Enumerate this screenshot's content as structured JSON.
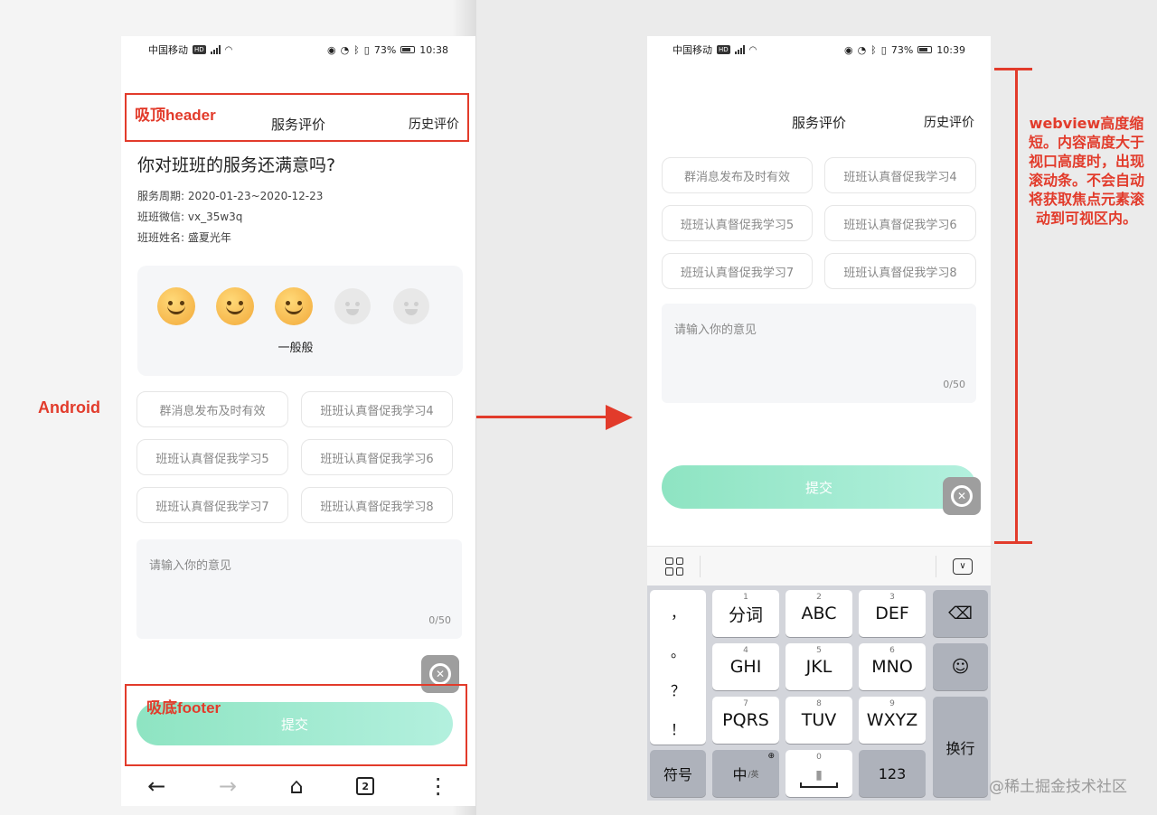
{
  "colors": {
    "annotation": "#e23b2b",
    "submit_gradient_start": "#8ee4c2",
    "submit_gradient_end": "#b3f0de"
  },
  "annotations": {
    "android_label": "Android",
    "header_label": "吸顶header",
    "footer_label": "吸底footer",
    "ios_note": "webview高度缩短。内容高度大于视口高度时，出现滚动条。不会自动将获取焦点元素滚动到可视区内。"
  },
  "left_phone": {
    "status": {
      "carrier": "中国移动",
      "hd": "HD",
      "signal": "4G",
      "battery": "73%",
      "time": "10:38"
    },
    "nav": {
      "title": "服务评价",
      "history": "历史评价"
    },
    "question": "你对班班的服务还满意吗?",
    "info": [
      {
        "label": "服务周期:",
        "value": "2020-01-23~2020-12-23"
      },
      {
        "label": "班班微信:",
        "value": "vx_35w3q"
      },
      {
        "label": "班班姓名:",
        "value": "盛夏光年"
      }
    ],
    "rating": {
      "selected_label": "一般般",
      "faces": [
        "happy-face-icon",
        "happy-face-icon",
        "happy-face-icon",
        "grey-face-icon",
        "grey-face-icon"
      ]
    },
    "tags": [
      "群消息发布及时有效",
      "班班认真督促我学习4",
      "班班认真督促我学习5",
      "班班认真督促我学习6",
      "班班认真督促我学习7",
      "班班认真督促我学习8"
    ],
    "textarea": {
      "placeholder": "请输入你的意见",
      "count": "0/50"
    },
    "submit": "提交",
    "browser_nav": {
      "back": "←",
      "forward": "→",
      "home": "⌂",
      "tabs": "2",
      "more": "⋮"
    }
  },
  "right_phone": {
    "status": {
      "carrier": "中国移动",
      "hd": "HD",
      "signal": "4G",
      "battery": "73%",
      "time": "10:39"
    },
    "nav": {
      "title": "服务评价",
      "history": "历史评价"
    },
    "tags": [
      "群消息发布及时有效",
      "班班认真督促我学习4",
      "班班认真督促我学习5",
      "班班认真督促我学习6",
      "班班认真督促我学习7",
      "班班认真督促我学习8"
    ],
    "textarea": {
      "placeholder": "请输入你的意见",
      "count": "0/50"
    },
    "submit": "提交",
    "keyboard": {
      "punctuation": [
        "，",
        "。",
        "？",
        "！"
      ],
      "row1": [
        {
          "num": "1",
          "label": "分词"
        },
        {
          "num": "2",
          "label": "ABC"
        },
        {
          "num": "3",
          "label": "DEF"
        }
      ],
      "row2": [
        {
          "num": "4",
          "label": "GHI"
        },
        {
          "num": "5",
          "label": "JKL"
        },
        {
          "num": "6",
          "label": "MNO"
        }
      ],
      "row3": [
        {
          "num": "7",
          "label": "PQRS"
        },
        {
          "num": "8",
          "label": "TUV"
        },
        {
          "num": "9",
          "label": "WXYZ"
        }
      ],
      "backspace": "⌫",
      "emoji": "☺",
      "enter": "换行",
      "symbols": "符号",
      "lang": "中",
      "lang_sub": "/英",
      "space_num": "0",
      "numbers": "123"
    }
  },
  "watermark": "@稀土掘金技术社区"
}
